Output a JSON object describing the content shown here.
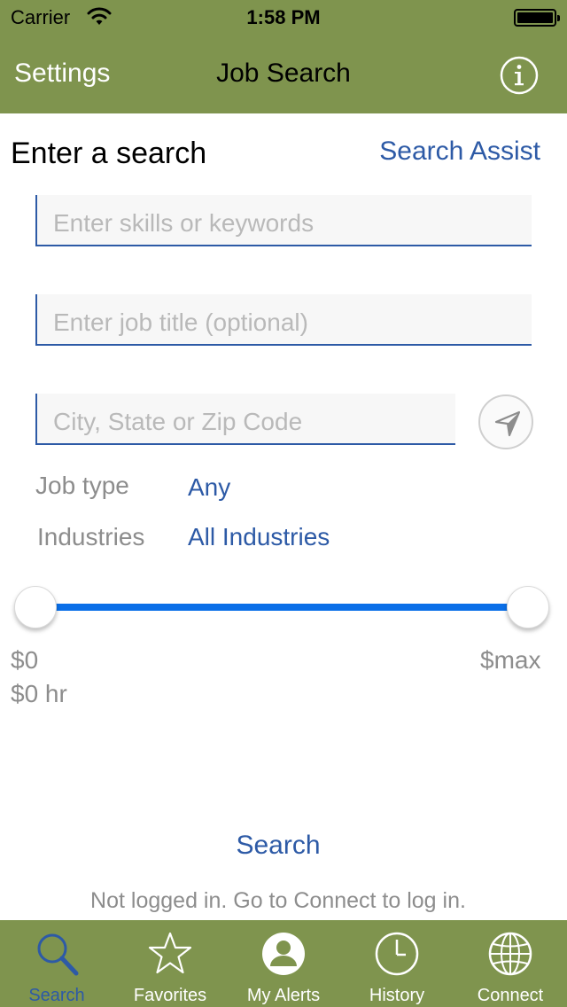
{
  "status_bar": {
    "carrier": "Carrier",
    "time": "1:58 PM"
  },
  "nav": {
    "left_label": "Settings",
    "title": "Job Search",
    "info_icon": "info-icon"
  },
  "form": {
    "section_title": "Enter a search",
    "search_assist_label": "Search Assist",
    "keywords": {
      "value": "",
      "placeholder": "Enter skills or keywords"
    },
    "job_title": {
      "value": "",
      "placeholder": "Enter job title (optional)"
    },
    "location": {
      "value": "",
      "placeholder": "City, State or Zip Code"
    },
    "job_type_label": "Job type",
    "job_type_value": "Any",
    "industries_label": "Industries",
    "industries_value": "All Industries"
  },
  "salary": {
    "min_label": "$0",
    "min_hourly_label": "$0 hr",
    "max_label": "$max",
    "range_fraction": [
      0,
      1
    ]
  },
  "actions": {
    "search_label": "Search",
    "login_note": "Not logged in. Go to Connect to log in."
  },
  "tabbar": {
    "items": [
      {
        "label": "Search",
        "icon": "search-icon",
        "active": true
      },
      {
        "label": "Favorites",
        "icon": "star-icon",
        "active": false
      },
      {
        "label": "My Alerts",
        "icon": "person-icon",
        "active": false
      },
      {
        "label": "History",
        "icon": "clock-icon",
        "active": false
      },
      {
        "label": "Connect",
        "icon": "globe-icon",
        "active": false
      }
    ]
  },
  "colors": {
    "header": "#7f944e",
    "accent_blue": "#2d5aa6",
    "slider": "#0a6fe8"
  }
}
